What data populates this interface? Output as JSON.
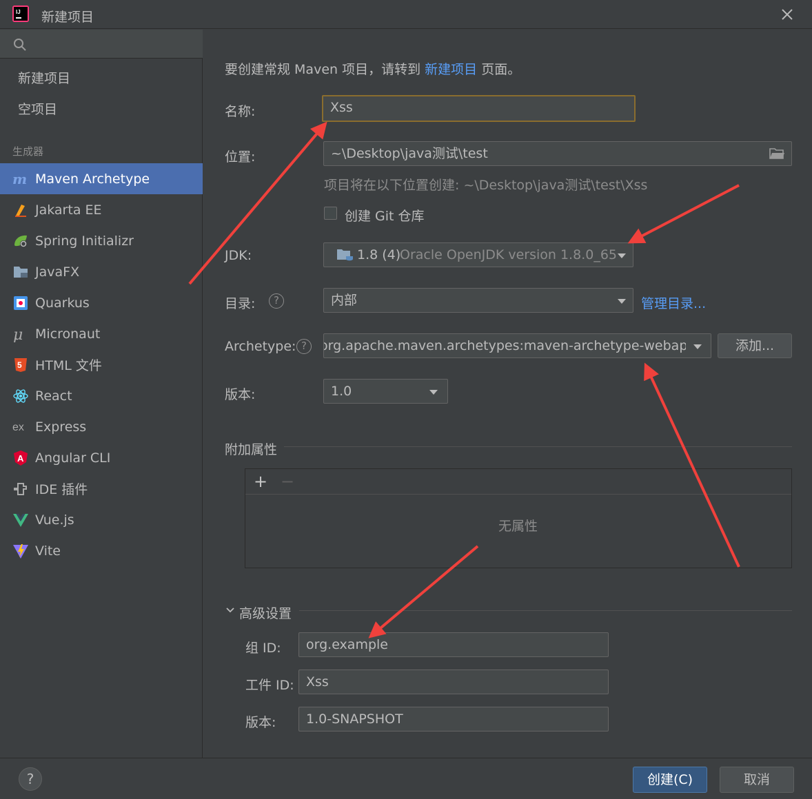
{
  "window": {
    "title": "新建项目",
    "app_icon": "intellij-icon",
    "close_icon": "close-icon"
  },
  "sidebar": {
    "search_icon": "search-icon",
    "top_items": [
      {
        "label": "新建项目"
      },
      {
        "label": "空项目"
      }
    ],
    "generators_heading": "生成器",
    "items": [
      {
        "label": "Maven Archetype",
        "icon": "maven-icon",
        "selected": true
      },
      {
        "label": "Jakarta EE",
        "icon": "jakarta-icon"
      },
      {
        "label": "Spring Initializr",
        "icon": "spring-icon"
      },
      {
        "label": "JavaFX",
        "icon": "javafx-icon"
      },
      {
        "label": "Quarkus",
        "icon": "quarkus-icon"
      },
      {
        "label": "Micronaut",
        "icon": "micronaut-icon"
      },
      {
        "label": "HTML 文件",
        "icon": "html5-icon"
      },
      {
        "label": "React",
        "icon": "react-icon"
      },
      {
        "label": "Express",
        "icon": "express-icon"
      },
      {
        "label": "Angular CLI",
        "icon": "angular-icon"
      },
      {
        "label": "IDE 插件",
        "icon": "plugin-icon"
      },
      {
        "label": "Vue.js",
        "icon": "vue-icon"
      },
      {
        "label": "Vite",
        "icon": "vite-icon"
      }
    ]
  },
  "main": {
    "hint_prefix": "要创建常规 Maven 项目，请转到 ",
    "hint_link": "新建项目",
    "hint_suffix": " 页面。",
    "name_label": "名称:",
    "name_value": "Xss",
    "location_label": "位置:",
    "location_value": "~\\Desktop\\java测试\\test",
    "location_hint": "项目将在以下位置创建: ~\\Desktop\\java测试\\test\\Xss",
    "git_label": "创建 Git 仓库",
    "jdk_label": "JDK:",
    "jdk_version": "1.8 (4)",
    "jdk_detail": "Oracle OpenJDK version 1.8.0_65",
    "catalog_label": "目录:",
    "catalog_value": "内部",
    "catalog_link": "管理目录...",
    "archetype_label": "Archetype:",
    "archetype_value": "org.apache.maven.archetypes:maven-archetype-webapp",
    "add_button": "添加...",
    "version_label": "版本:",
    "version_value": "1.0",
    "props_heading": "附加属性",
    "props_add": "+",
    "props_remove": "−",
    "props_empty": "无属性",
    "advanced_heading": "高级设置",
    "group_label": "组 ID:",
    "group_value": "org.example",
    "artifact_label": "工件 ID:",
    "artifact_value": "Xss",
    "adv_version_label": "版本:",
    "adv_version_value": "1.0-SNAPSHOT"
  },
  "footer": {
    "help": "?",
    "create": "创建(C)",
    "cancel": "取消"
  },
  "colors": {
    "selection": "#4b6eaf",
    "link": "#589df6",
    "annotation_arrow": "#f0413c",
    "focus_border": "#8a6d2e"
  }
}
